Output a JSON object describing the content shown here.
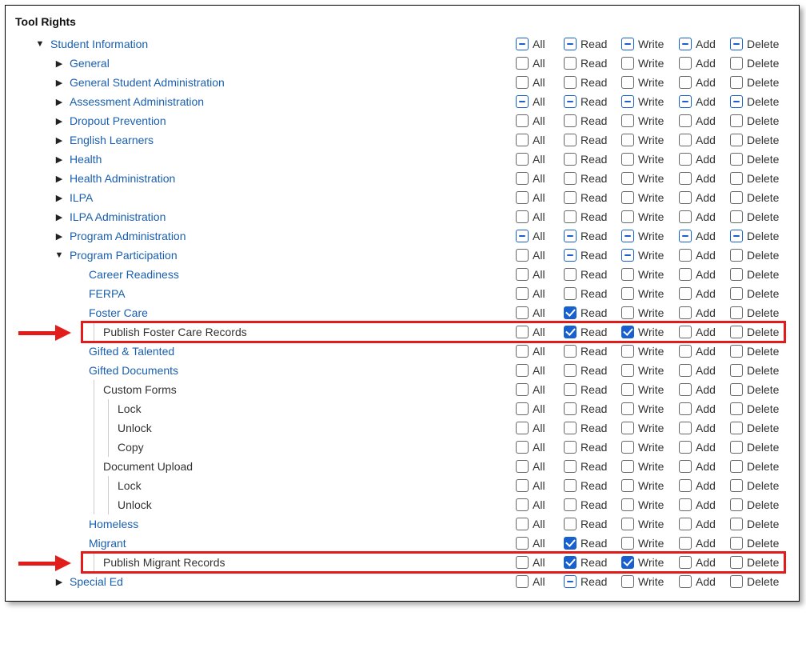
{
  "title": "Tool Rights",
  "perm_labels": {
    "all": "All",
    "read": "Read",
    "write": "Write",
    "add": "Add",
    "delete": "Delete"
  },
  "rows": [
    {
      "id": "student-info",
      "label": "Student Information",
      "indent": 1,
      "toggle": "down",
      "link": true,
      "states": {
        "all": "ind",
        "read": "ind",
        "write": "ind",
        "add": "ind",
        "delete": "ind"
      }
    },
    {
      "id": "general",
      "label": "General",
      "indent": 2,
      "toggle": "right",
      "link": true,
      "states": {
        "all": "off",
        "read": "off",
        "write": "off",
        "add": "off",
        "delete": "off"
      }
    },
    {
      "id": "gen-student-admin",
      "label": "General Student Administration",
      "indent": 2,
      "toggle": "right",
      "link": true,
      "states": {
        "all": "off",
        "read": "off",
        "write": "off",
        "add": "off",
        "delete": "off"
      }
    },
    {
      "id": "assessment-admin",
      "label": "Assessment Administration",
      "indent": 2,
      "toggle": "right",
      "link": true,
      "states": {
        "all": "ind",
        "read": "ind",
        "write": "ind",
        "add": "ind",
        "delete": "ind"
      }
    },
    {
      "id": "dropout-prev",
      "label": "Dropout Prevention",
      "indent": 2,
      "toggle": "right",
      "link": true,
      "states": {
        "all": "off",
        "read": "off",
        "write": "off",
        "add": "off",
        "delete": "off"
      }
    },
    {
      "id": "english-learners",
      "label": "English Learners",
      "indent": 2,
      "toggle": "right",
      "link": true,
      "states": {
        "all": "off",
        "read": "off",
        "write": "off",
        "add": "off",
        "delete": "off"
      }
    },
    {
      "id": "health",
      "label": "Health",
      "indent": 2,
      "toggle": "right",
      "link": true,
      "states": {
        "all": "off",
        "read": "off",
        "write": "off",
        "add": "off",
        "delete": "off"
      }
    },
    {
      "id": "health-admin",
      "label": "Health Administration",
      "indent": 2,
      "toggle": "right",
      "link": true,
      "states": {
        "all": "off",
        "read": "off",
        "write": "off",
        "add": "off",
        "delete": "off"
      }
    },
    {
      "id": "ilpa",
      "label": "ILPA",
      "indent": 2,
      "toggle": "right",
      "link": true,
      "states": {
        "all": "off",
        "read": "off",
        "write": "off",
        "add": "off",
        "delete": "off"
      }
    },
    {
      "id": "ilpa-admin",
      "label": "ILPA Administration",
      "indent": 2,
      "toggle": "right",
      "link": true,
      "states": {
        "all": "off",
        "read": "off",
        "write": "off",
        "add": "off",
        "delete": "off"
      }
    },
    {
      "id": "program-admin",
      "label": "Program Administration",
      "indent": 2,
      "toggle": "right",
      "link": true,
      "states": {
        "all": "ind",
        "read": "ind",
        "write": "ind",
        "add": "ind",
        "delete": "ind"
      }
    },
    {
      "id": "program-participation",
      "label": "Program Participation",
      "indent": 2,
      "toggle": "down",
      "link": true,
      "states": {
        "all": "off",
        "read": "ind",
        "write": "ind",
        "add": "off",
        "delete": "off"
      }
    },
    {
      "id": "career-readiness",
      "label": "Career Readiness",
      "indent": 3,
      "toggle": "",
      "link": true,
      "states": {
        "all": "off",
        "read": "off",
        "write": "off",
        "add": "off",
        "delete": "off"
      }
    },
    {
      "id": "ferpa",
      "label": "FERPA",
      "indent": 3,
      "toggle": "",
      "link": true,
      "states": {
        "all": "off",
        "read": "off",
        "write": "off",
        "add": "off",
        "delete": "off"
      }
    },
    {
      "id": "foster-care",
      "label": "Foster Care",
      "indent": 3,
      "toggle": "",
      "link": true,
      "states": {
        "all": "off",
        "read": "chk",
        "write": "off",
        "add": "off",
        "delete": "off"
      }
    },
    {
      "id": "publish-foster",
      "label": "Publish Foster Care Records",
      "indent": 4,
      "toggle": "",
      "link": false,
      "bar": 1,
      "states": {
        "all": "off",
        "read": "chk",
        "write": "chk",
        "add": "off",
        "delete": "off"
      },
      "highlight": true
    },
    {
      "id": "gifted-talented",
      "label": "Gifted & Talented",
      "indent": 3,
      "toggle": "",
      "link": true,
      "states": {
        "all": "off",
        "read": "off",
        "write": "off",
        "add": "off",
        "delete": "off"
      }
    },
    {
      "id": "gifted-documents",
      "label": "Gifted Documents",
      "indent": 3,
      "toggle": "",
      "link": true,
      "states": {
        "all": "off",
        "read": "off",
        "write": "off",
        "add": "off",
        "delete": "off"
      }
    },
    {
      "id": "custom-forms",
      "label": "Custom Forms",
      "indent": 4,
      "toggle": "",
      "link": false,
      "bar": 1,
      "states": {
        "all": "off",
        "read": "off",
        "write": "off",
        "add": "off",
        "delete": "off"
      }
    },
    {
      "id": "cf-lock",
      "label": "Lock",
      "indent": 5,
      "toggle": "",
      "link": false,
      "bar": 2,
      "states": {
        "all": "off",
        "read": "off",
        "write": "off",
        "add": "off",
        "delete": "off"
      }
    },
    {
      "id": "cf-unlock",
      "label": "Unlock",
      "indent": 5,
      "toggle": "",
      "link": false,
      "bar": 2,
      "states": {
        "all": "off",
        "read": "off",
        "write": "off",
        "add": "off",
        "delete": "off"
      }
    },
    {
      "id": "cf-copy",
      "label": "Copy",
      "indent": 5,
      "toggle": "",
      "link": false,
      "bar": 2,
      "states": {
        "all": "off",
        "read": "off",
        "write": "off",
        "add": "off",
        "delete": "off"
      }
    },
    {
      "id": "doc-upload",
      "label": "Document Upload",
      "indent": 4,
      "toggle": "",
      "link": false,
      "bar": 1,
      "states": {
        "all": "off",
        "read": "off",
        "write": "off",
        "add": "off",
        "delete": "off"
      }
    },
    {
      "id": "du-lock",
      "label": "Lock",
      "indent": 5,
      "toggle": "",
      "link": false,
      "bar": 2,
      "states": {
        "all": "off",
        "read": "off",
        "write": "off",
        "add": "off",
        "delete": "off"
      }
    },
    {
      "id": "du-unlock",
      "label": "Unlock",
      "indent": 5,
      "toggle": "",
      "link": false,
      "bar": 2,
      "states": {
        "all": "off",
        "read": "off",
        "write": "off",
        "add": "off",
        "delete": "off"
      }
    },
    {
      "id": "homeless",
      "label": "Homeless",
      "indent": 3,
      "toggle": "",
      "link": true,
      "states": {
        "all": "off",
        "read": "off",
        "write": "off",
        "add": "off",
        "delete": "off"
      }
    },
    {
      "id": "migrant",
      "label": "Migrant",
      "indent": 3,
      "toggle": "",
      "link": true,
      "states": {
        "all": "off",
        "read": "chk",
        "write": "off",
        "add": "off",
        "delete": "off"
      }
    },
    {
      "id": "publish-migrant",
      "label": "Publish Migrant Records",
      "indent": 4,
      "toggle": "",
      "link": false,
      "bar": 1,
      "states": {
        "all": "off",
        "read": "chk",
        "write": "chk",
        "add": "off",
        "delete": "off"
      },
      "highlight": true
    },
    {
      "id": "special-ed",
      "label": "Special Ed",
      "indent": 2,
      "toggle": "right",
      "link": true,
      "states": {
        "all": "off",
        "read": "ind",
        "write": "off",
        "add": "off",
        "delete": "off"
      }
    }
  ]
}
